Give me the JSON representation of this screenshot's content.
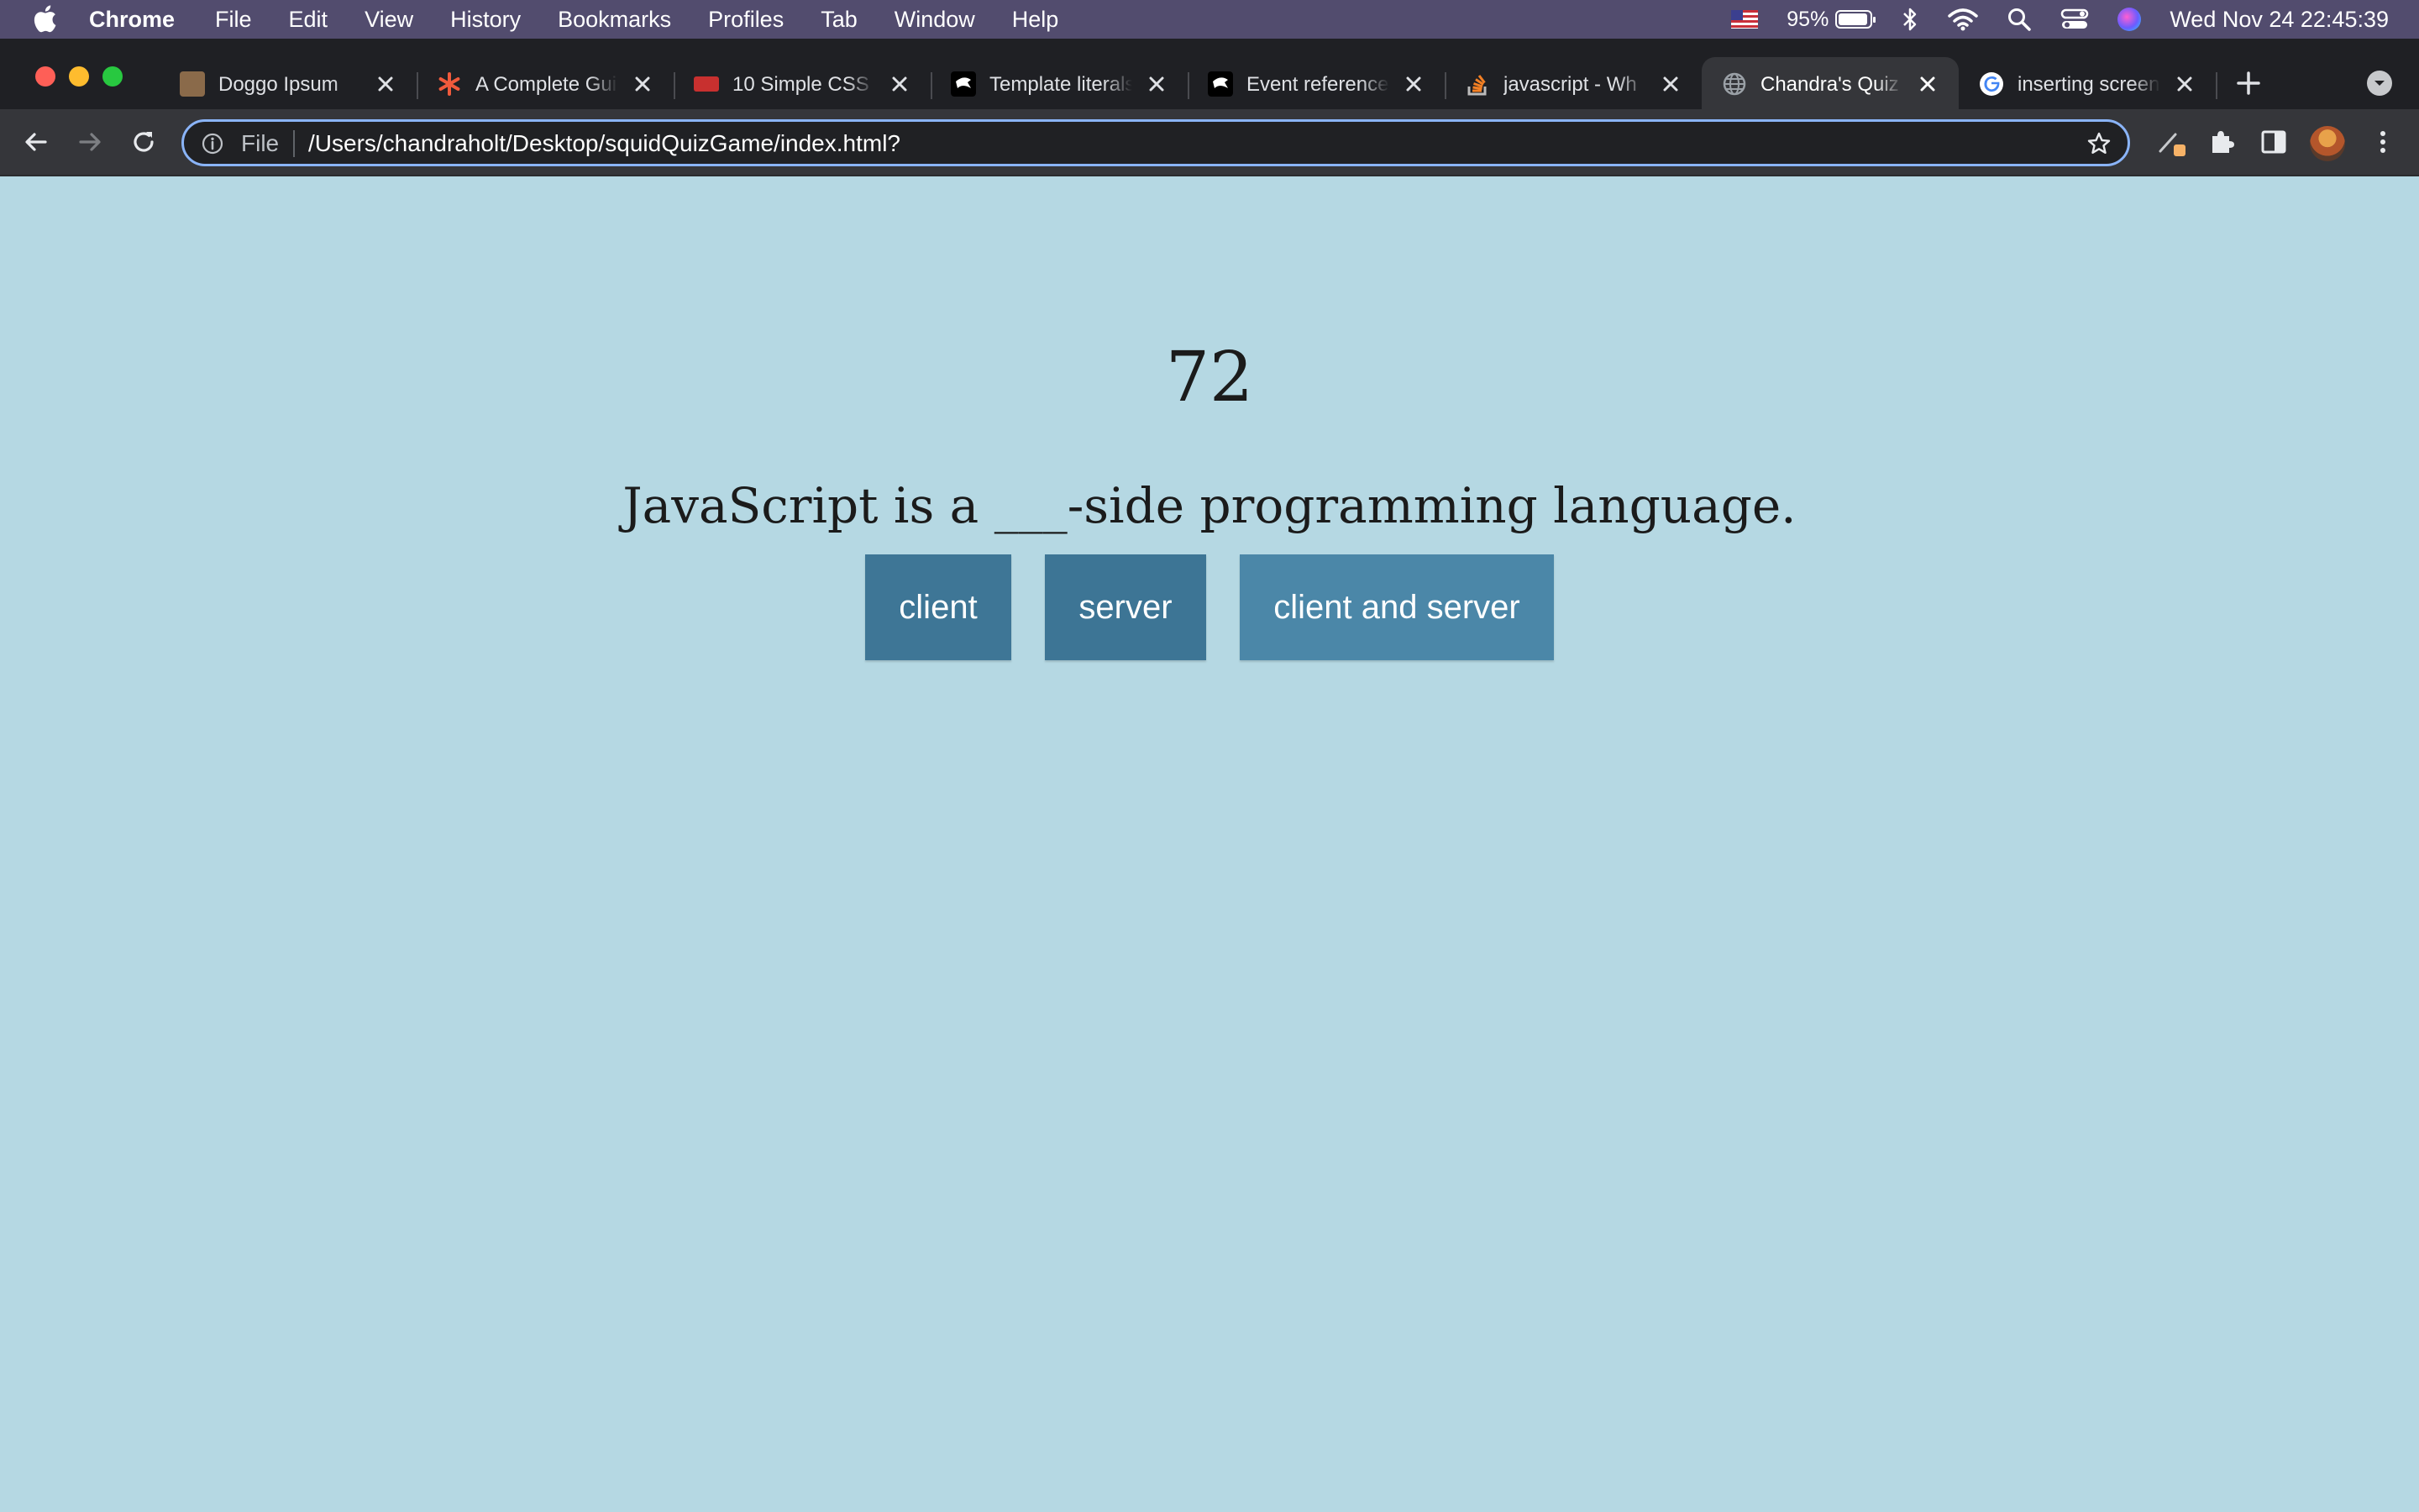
{
  "menubar": {
    "app": "Chrome",
    "items": [
      "File",
      "Edit",
      "View",
      "History",
      "Bookmarks",
      "Profiles",
      "Tab",
      "Window",
      "Help"
    ],
    "battery_percent": "95%",
    "battery_level": 0.95,
    "clock": "Wed Nov 24  22:45:39"
  },
  "tabs": [
    {
      "title": "Doggo Ipsum",
      "favicon": "dog-icon",
      "favicon_color": "#8a6a4a",
      "active": false
    },
    {
      "title": "A Complete Gui",
      "favicon": "asterisk-icon",
      "favicon_color": "#f05a3c",
      "active": false
    },
    {
      "title": "10 Simple CSS",
      "favicon": "red-badge-icon",
      "favicon_color": "#c8302f",
      "active": false
    },
    {
      "title": "Template literals",
      "favicon": "mdn-icon",
      "favicon_color": "#000000",
      "active": false
    },
    {
      "title": "Event reference",
      "favicon": "mdn-icon",
      "favicon_color": "#000000",
      "active": false
    },
    {
      "title": "javascript - Wh",
      "favicon": "stackoverflow-icon",
      "favicon_color": "#f48024",
      "active": false
    },
    {
      "title": "Chandra's Quiz",
      "favicon": "globe-icon",
      "favicon_color": "#9aa0a6",
      "active": true
    },
    {
      "title": "inserting screen",
      "favicon": "google-icon",
      "favicon_color": "#4285f4",
      "active": false
    }
  ],
  "omnibox": {
    "scheme": "File",
    "url": "/Users/chandraholt/Desktop/squidQuizGame/index.html?"
  },
  "quiz": {
    "timer": "72",
    "question": "JavaScript is a ___-side programming language.",
    "answers": [
      "client",
      "server",
      "client and server"
    ]
  },
  "colors": {
    "page_background": "#b5d8e3",
    "button": "#3f7898",
    "menubar": "#524c6e",
    "tabstrip": "#1f2024",
    "toolbar": "#35363a",
    "omnibox_focus": "#8ab4f8"
  }
}
